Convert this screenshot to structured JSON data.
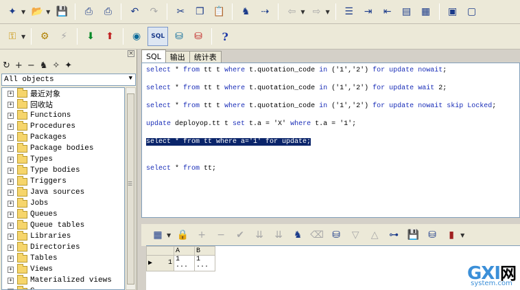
{
  "toolbar1": {
    "icons": [
      "new-icon",
      "open-icon",
      "save-icon",
      "print-icon",
      "print-preview-icon",
      "undo-icon",
      "redo-icon",
      "cut-icon",
      "copy-icon",
      "paste-icon",
      "find-icon",
      "find-next-icon",
      "back-icon",
      "forward-icon",
      "beautify-icon",
      "indent-icon",
      "unindent-icon",
      "comment-icon",
      "uncomment-icon",
      "execute-window-icon",
      "close-window-icon"
    ]
  },
  "toolbar2": {
    "icons": [
      "key-icon",
      "gear-icon",
      "break-icon",
      "export-icon",
      "import-icon",
      "session-icon",
      "sql-icon",
      "commit-icon",
      "rollback-icon",
      "help-icon"
    ],
    "help_label": "?"
  },
  "left_panel": {
    "tools": [
      "↻",
      "+",
      "−",
      "♞",
      "✧",
      "✦"
    ],
    "combo_value": "All objects",
    "tree_items": [
      "最近对象",
      "回收站",
      "Functions",
      "Procedures",
      "Packages",
      "Package bodies",
      "Types",
      "Type bodies",
      "Triggers",
      "Java sources",
      "Jobs",
      "Queues",
      "Queue tables",
      "Libraries",
      "Directories",
      "Tables",
      "Views",
      "Materialized views",
      "S..."
    ]
  },
  "tabs": [
    "SQL",
    "输出",
    "统计表"
  ],
  "editor": {
    "lines": [
      [
        {
          "t": "select",
          "k": 1
        },
        {
          "t": " * "
        },
        {
          "t": "from",
          "k": 1
        },
        {
          "t": " tt t "
        },
        {
          "t": "where",
          "k": 1
        },
        {
          "t": " t.quotation_code "
        },
        {
          "t": "in",
          "k": 1
        },
        {
          "t": " ('1','2') "
        },
        {
          "t": "for",
          "k": 1
        },
        {
          "t": " "
        },
        {
          "t": "update",
          "k": 1
        },
        {
          "t": " "
        },
        {
          "t": "nowait",
          "k": 1
        },
        {
          "t": ";"
        }
      ],
      [
        {
          "t": "select",
          "k": 1
        },
        {
          "t": " * "
        },
        {
          "t": "from",
          "k": 1
        },
        {
          "t": " tt t "
        },
        {
          "t": "where",
          "k": 1
        },
        {
          "t": " t.quotation_code "
        },
        {
          "t": "in",
          "k": 1
        },
        {
          "t": " ('1','2') "
        },
        {
          "t": "for",
          "k": 1
        },
        {
          "t": " "
        },
        {
          "t": "update",
          "k": 1
        },
        {
          "t": " "
        },
        {
          "t": "wait",
          "k": 1
        },
        {
          "t": " 2;"
        }
      ],
      [
        {
          "t": "select",
          "k": 1
        },
        {
          "t": " * "
        },
        {
          "t": "from",
          "k": 1
        },
        {
          "t": " tt t "
        },
        {
          "t": "where",
          "k": 1
        },
        {
          "t": " t.quotation_code "
        },
        {
          "t": "in",
          "k": 1
        },
        {
          "t": " ('1','2') "
        },
        {
          "t": "for",
          "k": 1
        },
        {
          "t": " "
        },
        {
          "t": "update",
          "k": 1
        },
        {
          "t": " "
        },
        {
          "t": "nowait",
          "k": 1
        },
        {
          "t": " "
        },
        {
          "t": "skip",
          "k": 1
        },
        {
          "t": " "
        },
        {
          "t": "Locked",
          "k": 1
        },
        {
          "t": ";"
        }
      ],
      [
        {
          "t": "update",
          "k": 1
        },
        {
          "t": " deployop.tt t "
        },
        {
          "t": "set",
          "k": 1
        },
        {
          "t": " t.a = 'X' "
        },
        {
          "t": "where",
          "k": 1
        },
        {
          "t": " t.a = '1';"
        }
      ],
      [
        {
          "t": "select * from tt where a='1' for update;",
          "s": 1
        }
      ],
      [
        {
          "t": "select",
          "k": 1
        },
        {
          "t": " * "
        },
        {
          "t": "from",
          "k": 1
        },
        {
          "t": " tt;"
        }
      ]
    ]
  },
  "result_toolbar": {
    "icons": [
      "grid-icon",
      "lock-icon",
      "add-record-icon",
      "delete-record-icon",
      "post-icon",
      "fetch-next-icon",
      "fetch-last-icon",
      "find-icon",
      "clear-icon",
      "export-icon",
      "prev-icon",
      "next-icon",
      "tree-icon",
      "save-icon",
      "query-icon",
      "chart-icon"
    ]
  },
  "result_grid": {
    "columns": [
      "A",
      "B"
    ],
    "rows": [
      {
        "marker": "▶",
        "num": "1",
        "cells": [
          "1 ···",
          "1 ···"
        ]
      }
    ]
  },
  "watermark": {
    "main": "GXI",
    "cn": "网",
    "sub": "system.com"
  }
}
